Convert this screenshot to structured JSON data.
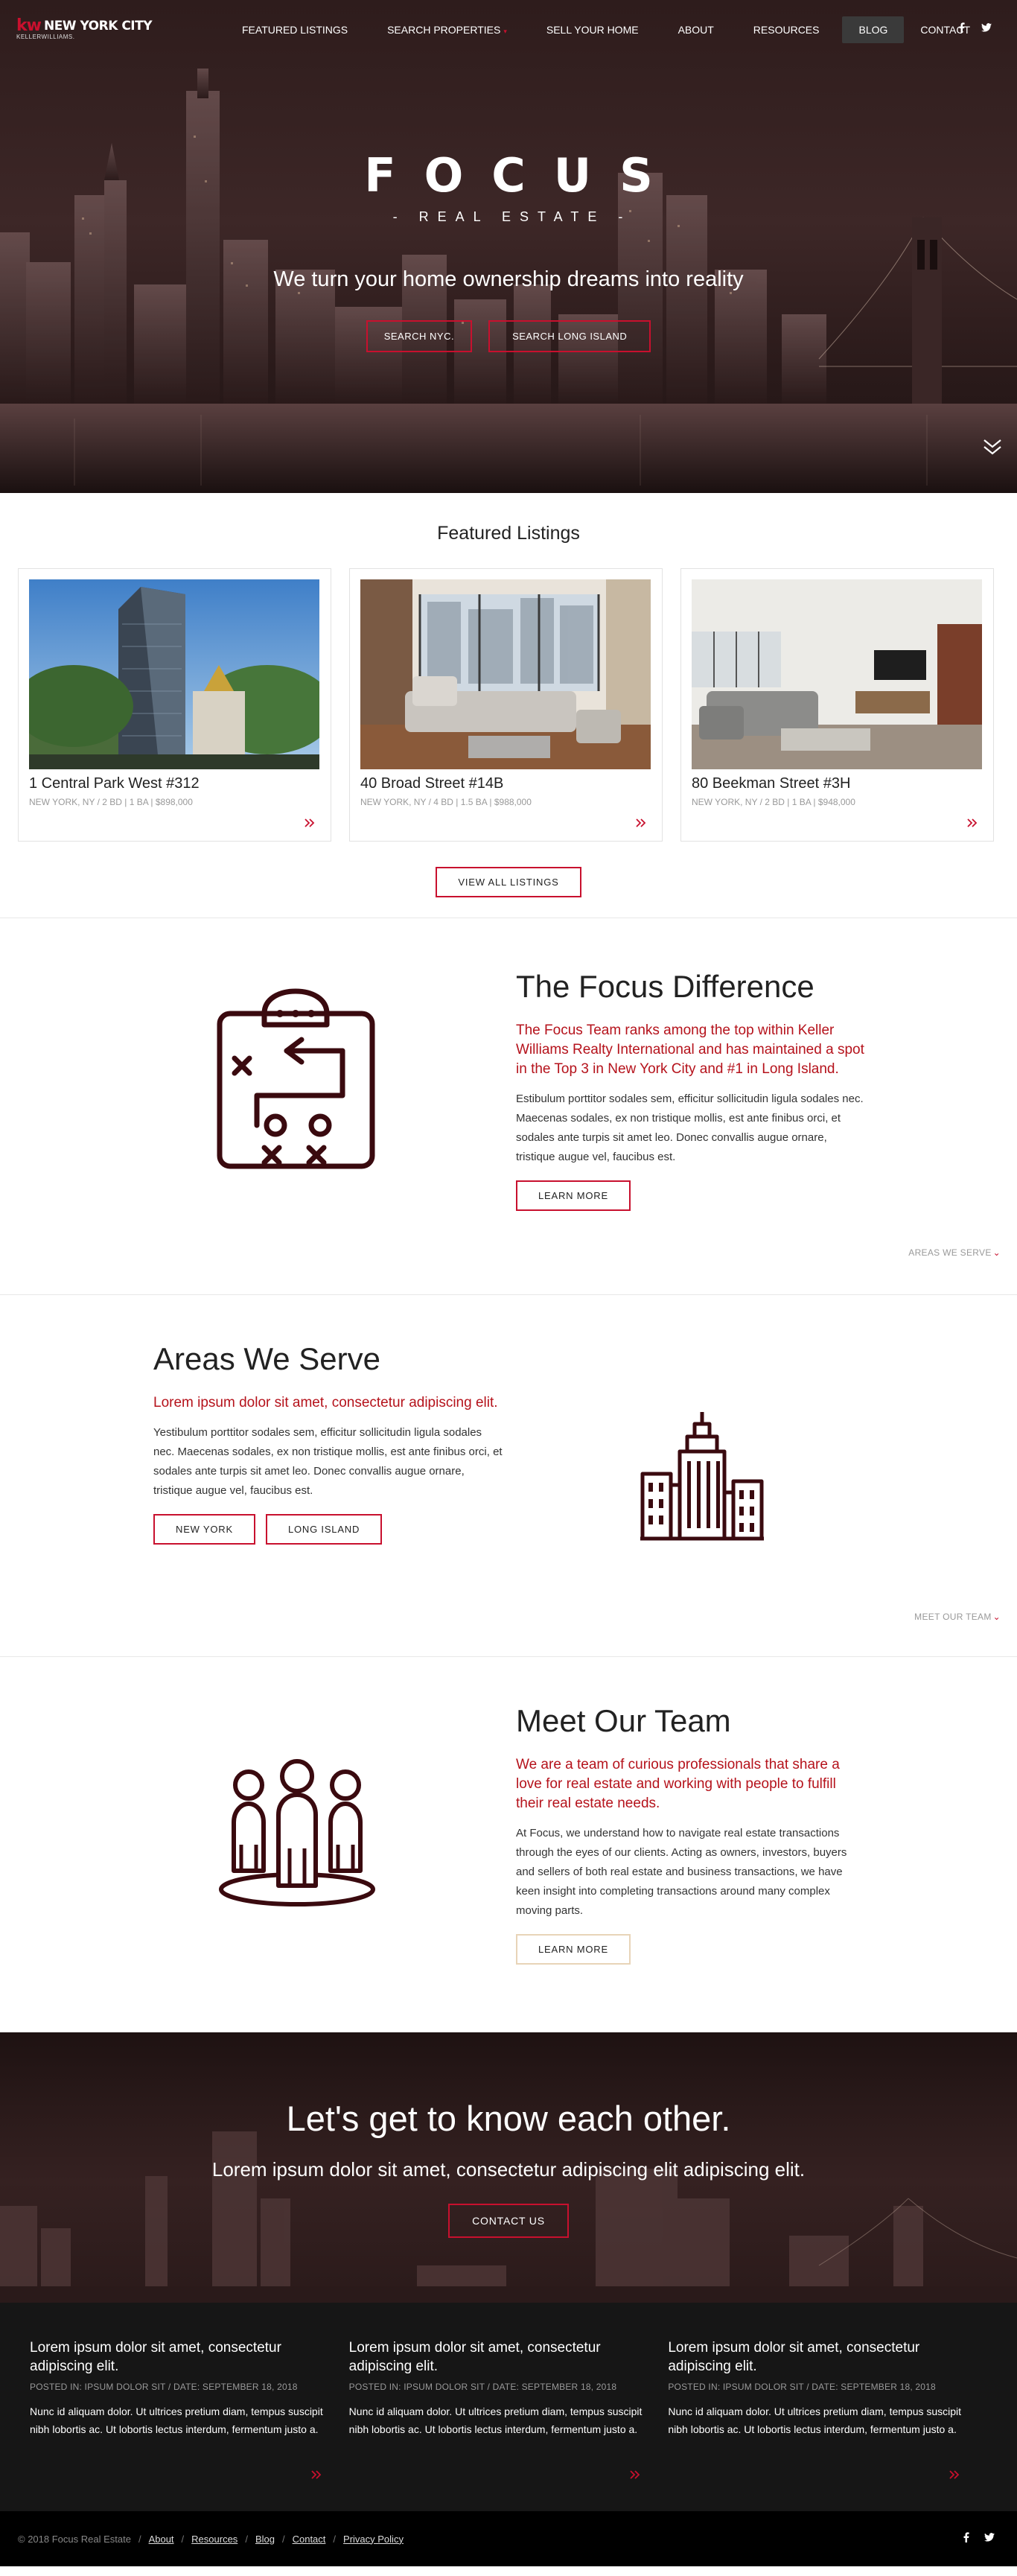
{
  "brand": {
    "kw": "kw",
    "city": "NEW YORK CITY",
    "sub": "KELLERWILLIAMS."
  },
  "nav": {
    "featured": "FEATURED LISTINGS",
    "search": "SEARCH PROPERTIES",
    "sell": "SELL YOUR HOME",
    "about": "ABOUT",
    "resources": "RESOURCES",
    "blog": "BLOG",
    "contact": "CONTACT",
    "social": [
      "facebook-icon",
      "twitter-icon"
    ]
  },
  "hero": {
    "title": "FOCUS",
    "subtitle": "- REAL ESTATE -",
    "tagline": "We turn your home ownership dreams into reality",
    "btn_nyc": "SEARCH NYC.",
    "btn_li": "SEARCH LONG ISLAND"
  },
  "featured": {
    "title": "Featured Listings",
    "view_all": "VIEW ALL LISTINGS",
    "listings": [
      {
        "title": "1 Central Park West #312",
        "meta": "NEW YORK, NY / 2 BD | 1 BA | $898,000"
      },
      {
        "title": "40 Broad Street #14B",
        "meta": "NEW YORK, NY / 4 BD | 1.5 BA | $988,000"
      },
      {
        "title": "80 Beekman Street #3H",
        "meta": "NEW YORK, NY / 2 BD | 1 BA | $948,000"
      }
    ]
  },
  "difference": {
    "title": "The Focus Difference",
    "lead": "The Focus Team ranks among the top within Keller Williams Realty International and has maintained a spot in the Top 3 in New York City and #1 in Long Island.",
    "body": "Estibulum porttitor sodales sem, efficitur sollicitudin ligula sodales nec. Maecenas sodales, ex non tristique mollis, est ante finibus orci, et sodales ante turpis sit amet leo. Donec convallis augue ornare, tristique augue vel, faucibus est.",
    "button": "LEARN MORE",
    "next_link": "AREAS WE SERVE"
  },
  "areas": {
    "title": "Areas We Serve",
    "lead": "Lorem ipsum dolor sit amet, consectetur adipiscing elit.",
    "body": "Yestibulum porttitor sodales sem, efficitur sollicitudin ligula sodales nec. Maecenas sodales, ex non tristique mollis, est ante finibus orci, et sodales ante turpis sit amet leo. Donec convallis augue ornare, tristique augue vel, faucibus est.",
    "btn_ny": "NEW YORK",
    "btn_li": "LONG ISLAND",
    "next_link": "MEET OUR TEAM"
  },
  "team": {
    "title": "Meet Our Team",
    "lead": "We are a team of curious professionals that share a love for real estate and working with people to fulfill their real estate needs.",
    "body": "At Focus, we understand how to navigate real estate transactions through the eyes of our clients. Acting as owners, investors, buyers and sellers of both real estate and business transactions, we have keen insight into completing transactions around many complex moving parts.",
    "button": "LEARN MORE"
  },
  "cta": {
    "title": "Let's get to know each other.",
    "subtitle": "Lorem ipsum dolor sit amet, consectetur adipiscing elit adipiscing elit.",
    "button": "CONTACT US"
  },
  "posts": [
    {
      "title": "Lorem ipsum dolor sit amet, consectetur adipiscing elit.",
      "meta": "POSTED IN: IPSUM DOLOR SIT / DATE: SEPTEMBER 18, 2018",
      "text": "Nunc id aliquam dolor. Ut ultrices pretium diam, tempus suscipit nibh lobortis ac. Ut lobortis lectus interdum, fermentum justo a."
    },
    {
      "title": "Lorem ipsum dolor sit amet, consectetur adipiscing elit.",
      "meta": "POSTED IN: IPSUM DOLOR SIT / DATE: SEPTEMBER 18, 2018",
      "text": "Nunc id aliquam dolor. Ut ultrices pretium diam, tempus suscipit nibh lobortis ac. Ut lobortis lectus interdum, fermentum justo a."
    },
    {
      "title": "Lorem ipsum dolor sit amet, consectetur adipiscing elit.",
      "meta": "POSTED IN: IPSUM DOLOR SIT / DATE: SEPTEMBER 18, 2018",
      "text": "Nunc id aliquam dolor. Ut ultrices pretium diam, tempus suscipit nibh lobortis ac. Ut lobortis lectus interdum, fermentum justo a."
    }
  ],
  "footer": {
    "copyright": "© 2018 Focus Real Estate",
    "links": [
      "About",
      "Resources",
      "Blog",
      "Contact",
      "Privacy Policy"
    ],
    "separator": "/"
  },
  "colors": {
    "accent": "#c8102e",
    "icon": "#3a0a0f",
    "dark": "#161616"
  }
}
